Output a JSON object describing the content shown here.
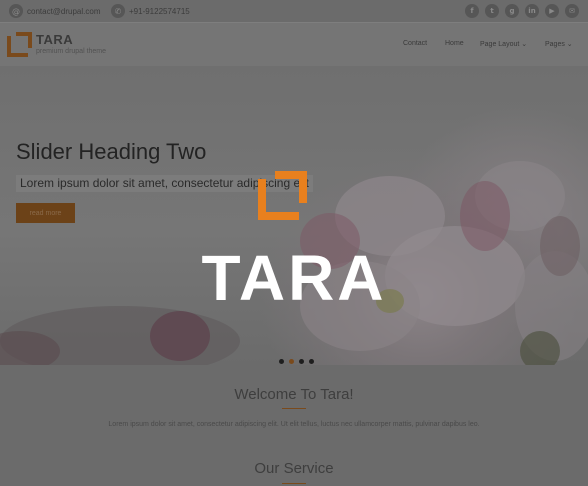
{
  "topbar": {
    "email": "contact@drupal.com",
    "email_icon": "email-icon",
    "phone": "+91-9122574715",
    "phone_icon": "phone-icon",
    "social": [
      "facebook-icon",
      "twitter-icon",
      "google-plus-icon",
      "linkedin-icon",
      "youtube-icon",
      "mail-icon"
    ]
  },
  "header": {
    "logo_title": "TARA",
    "logo_subtitle": "premium drupal theme",
    "nav": [
      {
        "label": "Contact"
      },
      {
        "label": "Home"
      },
      {
        "label": "Page Layout ⌄"
      },
      {
        "label": "Pages ⌄"
      }
    ]
  },
  "slider": {
    "heading": "Slider Heading Two",
    "text": "Lorem ipsum dolor sit amet, consectetur adipiscing elit",
    "button_label": "read more",
    "dots": 4,
    "active_dot": 2
  },
  "welcome": {
    "title": "Welcome To Tara!",
    "text": "Lorem ipsum dolor sit amet, consectetur adipiscing elit. Ut elit tellus, luctus nec ullamcorper mattis, pulvinar dapibus leo."
  },
  "service": {
    "title": "Our Service"
  },
  "splash": {
    "title": "TARA"
  },
  "colors": {
    "accent": "#e8801e",
    "overlay": "#000000",
    "splash_text": "#ffffff"
  }
}
